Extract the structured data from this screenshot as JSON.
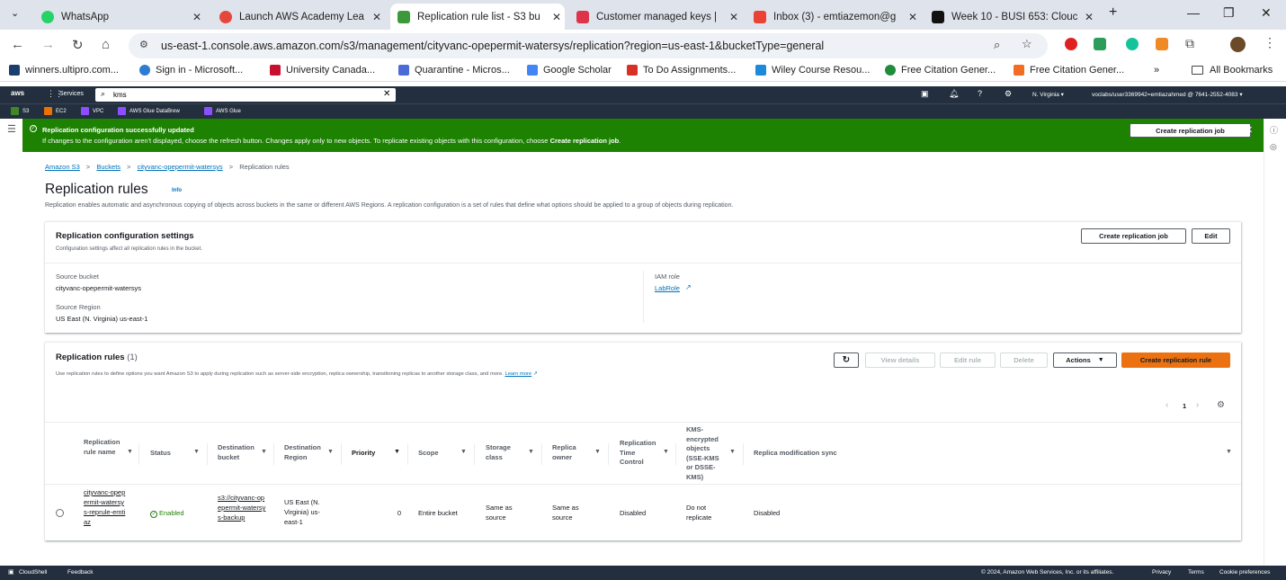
{
  "browser": {
    "tabs": [
      {
        "title": "WhatsApp",
        "icon": "whatsapp-icon",
        "color": "#25d366"
      },
      {
        "title": "Launch AWS Academy Lea",
        "icon": "aws-academy-icon",
        "color": "#e5473c"
      },
      {
        "title": "Replication rule list - S3 bu",
        "icon": "s3-icon",
        "color": "#3a9a3a"
      },
      {
        "title": "Customer managed keys |",
        "icon": "kms-icon",
        "color": "#dd344c"
      },
      {
        "title": "Inbox (3) - emtiazemon@g",
        "icon": "gmail-icon",
        "color": "#ea4335"
      },
      {
        "title": "Week 10 - BUSI 653: Clouc",
        "icon": "d2l-icon",
        "color": "#111111"
      }
    ],
    "url": "us-east-1.console.aws.amazon.com/s3/management/cityvanc-opepermit-watersys/replication?region=us-east-1&bucketType=general",
    "bookmarks": [
      {
        "label": "winners.ultipro.com...",
        "color": "#1a3e6e"
      },
      {
        "label": "Sign in - Microsoft...",
        "color": "#2b7cd3"
      },
      {
        "label": "University Canada...",
        "color": "#c8102e"
      },
      {
        "label": "Quarantine - Micros...",
        "color": "#4b6bd6"
      },
      {
        "label": "Google Scholar",
        "color": "#4285f4"
      },
      {
        "label": "To Do Assignments...",
        "color": "#d93025"
      },
      {
        "label": "Wiley Course Resou...",
        "color": "#1c8adb"
      },
      {
        "label": "Free Citation Gener...",
        "color": "#1e8c3a"
      },
      {
        "label": "Free Citation Gener...",
        "color": "#f26c21"
      }
    ],
    "all_bookmarks": "All Bookmarks",
    "more": "»"
  },
  "aws": {
    "logo": "aws",
    "services": "Services",
    "search_value": "kms",
    "region": "N. Virginia ▾",
    "account": "voclabs/user3369942=emtiazahmed @ 7641-2552-4083 ▾",
    "favorites": [
      {
        "label": "S3",
        "color": "#3f8624"
      },
      {
        "label": "EC2",
        "color": "#ed7100"
      },
      {
        "label": "VPC",
        "color": "#8c4fff"
      },
      {
        "label": "AWS Glue DataBrew",
        "color": "#8c4fff"
      },
      {
        "label": "AWS Glue",
        "color": "#8c4fff"
      }
    ]
  },
  "flash": {
    "title": "Replication configuration successfully updated",
    "body": "If changes to the configuration aren't displayed, choose the refresh button. Changes apply only to new objects. To replicate existing objects with this configuration, choose",
    "body_bold": "Create replication job",
    "button": "Create replication job"
  },
  "breadcrumb": [
    "Amazon S3",
    "Buckets",
    "cityvanc-opepermit-watersys",
    "Replication rules"
  ],
  "page": {
    "title": "Replication rules",
    "info": "Info",
    "description": "Replication enables automatic and asynchronous copying of objects across buckets in the same or different AWS Regions. A replication configuration is a set of rules that define what options should be applied to a group of objects during replication."
  },
  "settings": {
    "title": "Replication configuration settings",
    "subtitle": "Configuration settings affect all replication rules in the bucket.",
    "create_job": "Create replication job",
    "edit": "Edit",
    "source_bucket_label": "Source bucket",
    "source_bucket": "cityvanc-opepermit-watersys",
    "source_region_label": "Source Region",
    "source_region": "US East (N. Virginia) us-east-1",
    "iam_role_label": "IAM role",
    "iam_role": "LabRole"
  },
  "rules": {
    "title": "Replication rules",
    "count": "(1)",
    "description": "Use replication rules to define options you want Amazon S3 to apply during replication such as server-side encryption, replica ownership, transitioning replicas to another storage class, and more.",
    "learn_more": "Learn more",
    "buttons": {
      "view": "View details",
      "edit": "Edit rule",
      "delete": "Delete",
      "actions": "Actions",
      "create": "Create replication rule"
    },
    "page": "1",
    "columns": [
      "Replication rule name",
      "Status",
      "Destination bucket",
      "Destination Region",
      "Priority",
      "Scope",
      "Storage class",
      "Replica owner",
      "Replication Time Control",
      "KMS-encrypted objects (SSE-KMS or DSSE-KMS)",
      "Replica modification sync"
    ],
    "row": {
      "name": "cityvanc-opepermit-watersys-reprule-emtiaz",
      "status": "Enabled",
      "dest_bucket": "s3://cityvanc-opepermit-watersys-backup",
      "dest_region": "US East (N. Virginia) us-east-1",
      "priority": "0",
      "scope": "Entire bucket",
      "storage_class": "Same as source",
      "replica_owner": "Same as source",
      "rtc": "Disabled",
      "kms": "Do not replicate",
      "mod_sync": "Disabled"
    }
  },
  "footer": {
    "cloudshell": "CloudShell",
    "feedback": "Feedback",
    "copyright": "© 2024, Amazon Web Services, Inc. or its affiliates.",
    "privacy": "Privacy",
    "terms": "Terms",
    "cookies": "Cookie preferences"
  }
}
